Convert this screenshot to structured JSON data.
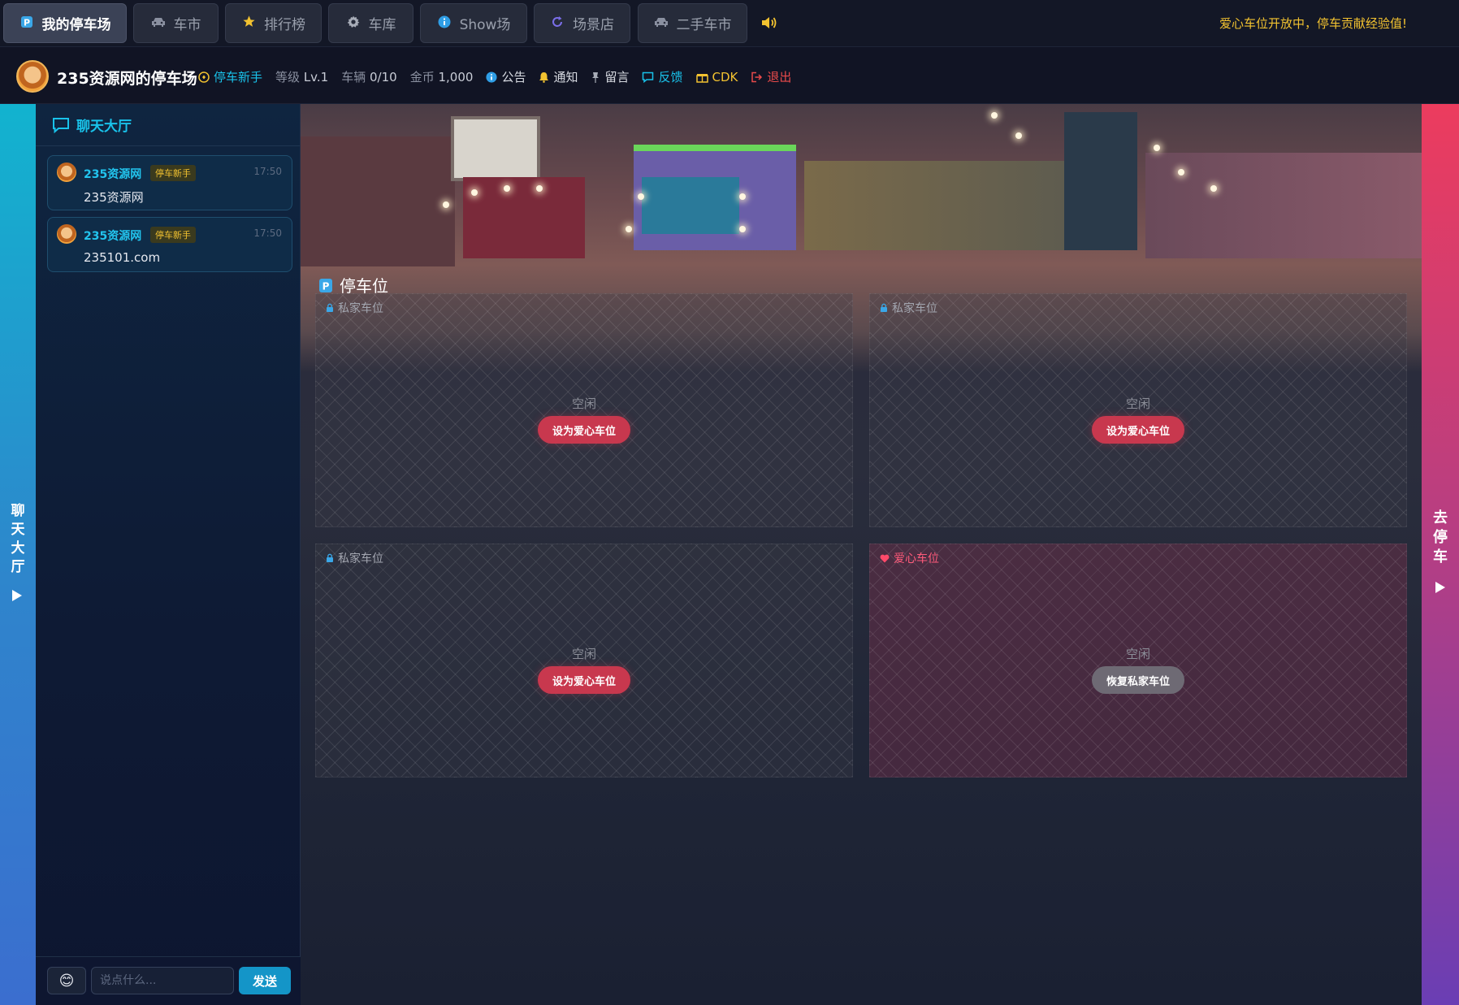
{
  "nav": {
    "tabs": [
      {
        "label": "我的停车场",
        "icon": "parking-icon"
      },
      {
        "label": "车市",
        "icon": "car-icon"
      },
      {
        "label": "排行榜",
        "icon": "star-icon"
      },
      {
        "label": "车库",
        "icon": "gear-icon"
      },
      {
        "label": "Show场",
        "icon": "info-icon"
      },
      {
        "label": "场景店",
        "icon": "refresh-icon"
      },
      {
        "label": "二手车市",
        "icon": "car-icon"
      }
    ],
    "announcement": "爱心车位开放中，停车贡献经验值!"
  },
  "info": {
    "title": "235资源网的停车场",
    "rank": "停车新手",
    "level_label": "等级",
    "level_value": "Lv.1",
    "vehicles_label": "车辆",
    "vehicles_value": "0/10",
    "coins_label": "金币",
    "coins_value": "1,000",
    "links": {
      "notice": "公告",
      "notify": "通知",
      "message": "留言",
      "feedback": "反馈",
      "cdk": "CDK",
      "logout": "退出"
    }
  },
  "colors": {
    "accent": "#19c2ea",
    "gold": "#f2c230",
    "love": "#c8384e",
    "logout": "#e84a4a"
  },
  "left_strip": {
    "label": "聊天大厅"
  },
  "chat": {
    "title": "聊天大厅",
    "messages": [
      {
        "user": "235资源网",
        "badge": "停车新手",
        "time": "17:50",
        "text": "235资源网"
      },
      {
        "user": "235资源网",
        "badge": "停车新手",
        "time": "17:50",
        "text": "235101.com"
      }
    ],
    "input_placeholder": "说点什么...",
    "send_label": "发送",
    "emoji": "😊"
  },
  "lot": {
    "title": "停车位",
    "slots": [
      {
        "tag": "私家车位",
        "type": "private",
        "state": "空闲",
        "action": "设为爱心车位"
      },
      {
        "tag": "私家车位",
        "type": "private",
        "state": "空闲",
        "action": "设为爱心车位"
      },
      {
        "tag": "私家车位",
        "type": "private",
        "state": "空闲",
        "action": "设为爱心车位"
      },
      {
        "tag": "爱心车位",
        "type": "love",
        "state": "空闲",
        "action": "恢复私家车位"
      }
    ]
  },
  "right_strip": {
    "label": "去停车"
  }
}
